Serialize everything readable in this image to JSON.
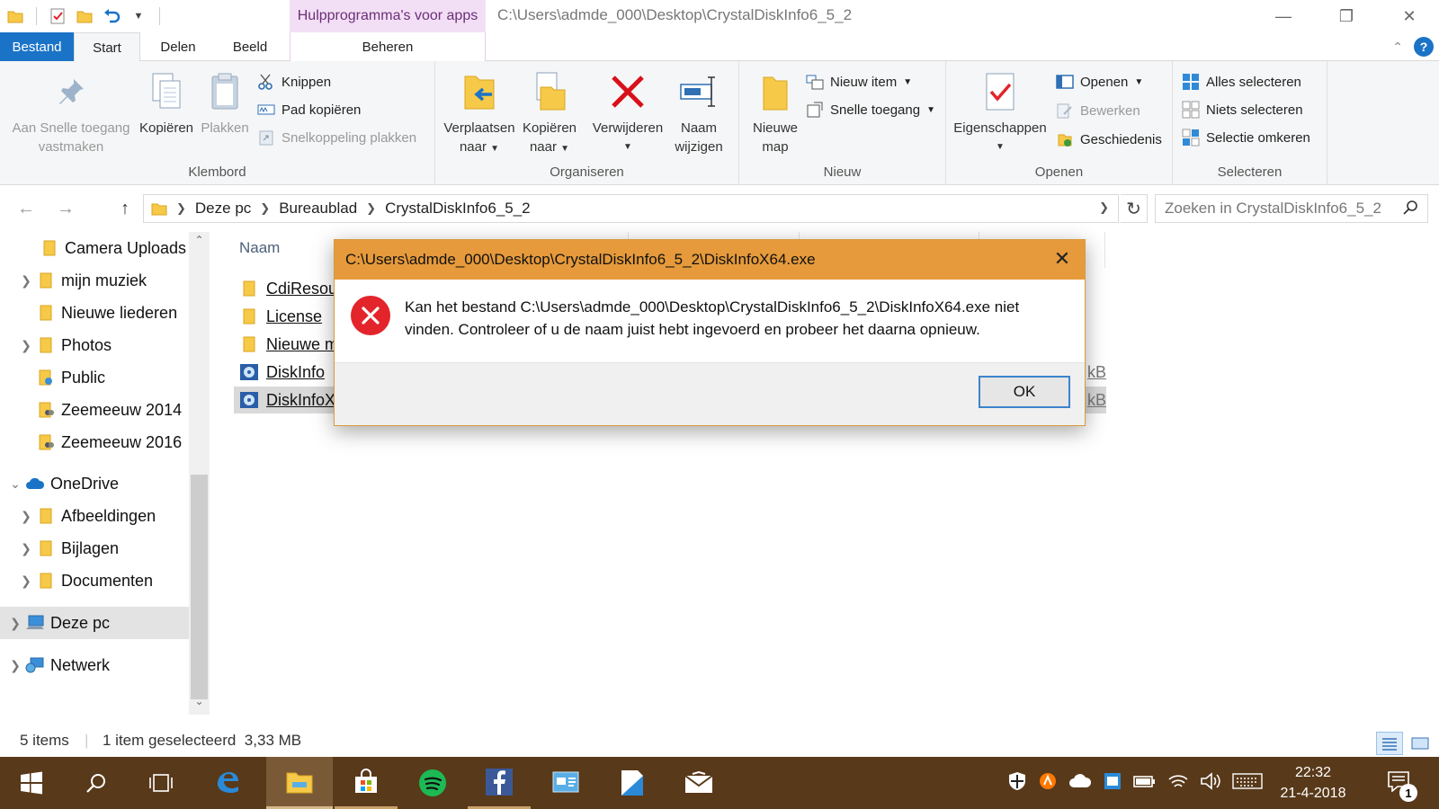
{
  "window": {
    "title": "C:\\Users\\admde_000\\Desktop\\CrystalDiskInfo6_5_2",
    "context_tab_header": "Hulpprogramma's voor apps"
  },
  "tabs": {
    "file": "Bestand",
    "home": "Start",
    "share": "Delen",
    "view": "Beeld",
    "manage": "Beheren"
  },
  "ribbon": {
    "clipboard": {
      "label": "Klembord",
      "pin_line1": "Aan Snelle toegang",
      "pin_line2": "vastmaken",
      "copy": "Kopiëren",
      "paste": "Plakken",
      "cut": "Knippen",
      "copy_path": "Pad kopiëren",
      "paste_shortcut": "Snelkoppeling plakken"
    },
    "organize": {
      "label": "Organiseren",
      "move_line1": "Verplaatsen",
      "move_line2": "naar",
      "copy_line1": "Kopiëren",
      "copy_line2": "naar",
      "delete": "Verwijderen",
      "rename_line1": "Naam",
      "rename_line2": "wijzigen"
    },
    "new": {
      "label": "Nieuw",
      "folder_line1": "Nieuwe",
      "folder_line2": "map",
      "new_item": "Nieuw item",
      "easy_access": "Snelle toegang"
    },
    "open": {
      "label": "Openen",
      "properties": "Eigenschappen",
      "open": "Openen",
      "edit": "Bewerken",
      "history": "Geschiedenis"
    },
    "select": {
      "label": "Selecteren",
      "select_all": "Alles selecteren",
      "select_none": "Niets selecteren",
      "invert": "Selectie omkeren"
    }
  },
  "address": {
    "crumbs": [
      "Deze pc",
      "Bureaublad",
      "CrystalDiskInfo6_5_2"
    ],
    "search_placeholder": "Zoeken in CrystalDiskInfo6_5_2"
  },
  "navpane": {
    "items": [
      {
        "label": "Camera Uploads"
      },
      {
        "label": "mijn muziek"
      },
      {
        "label": "Nieuwe liederen"
      },
      {
        "label": "Photos"
      },
      {
        "label": "Public"
      },
      {
        "label": "Zeemeeuw 2014"
      },
      {
        "label": "Zeemeeuw 2016"
      },
      {
        "label": "OneDrive"
      },
      {
        "label": "Afbeeldingen"
      },
      {
        "label": "Bijlagen"
      },
      {
        "label": "Documenten"
      },
      {
        "label": "Deze pc"
      },
      {
        "label": "Netwerk"
      }
    ]
  },
  "filelist": {
    "column_name": "Naam",
    "rows": [
      {
        "name": "CdiResou",
        "size": ""
      },
      {
        "name": "License",
        "size": ""
      },
      {
        "name": "Nieuwe m",
        "size": ""
      },
      {
        "name": "DiskInfo",
        "size": "kB"
      },
      {
        "name": "DiskInfoX",
        "size": "kB"
      }
    ]
  },
  "status": {
    "count": "5 items",
    "selection": "1 item geselecteerd  3,33 MB"
  },
  "dialog": {
    "title": "C:\\Users\\admde_000\\Desktop\\CrystalDiskInfo6_5_2\\DiskInfoX64.exe",
    "message_line1": "Kan het bestand C:\\Users\\admde_000\\Desktop\\CrystalDiskInfo6_5_2\\DiskInfoX64.exe niet",
    "message_line2": "vinden. Controleer of u de naam juist hebt ingevoerd en probeer het daarna opnieuw.",
    "ok": "OK"
  },
  "taskbar": {
    "time": "22:32",
    "date": "21-4-2018",
    "notifications": "1"
  },
  "colors": {
    "accent": "#1a73c7",
    "dialog_title": "#e69a3b",
    "taskbar": "#58391a",
    "context_tab": "#f3dff5"
  }
}
